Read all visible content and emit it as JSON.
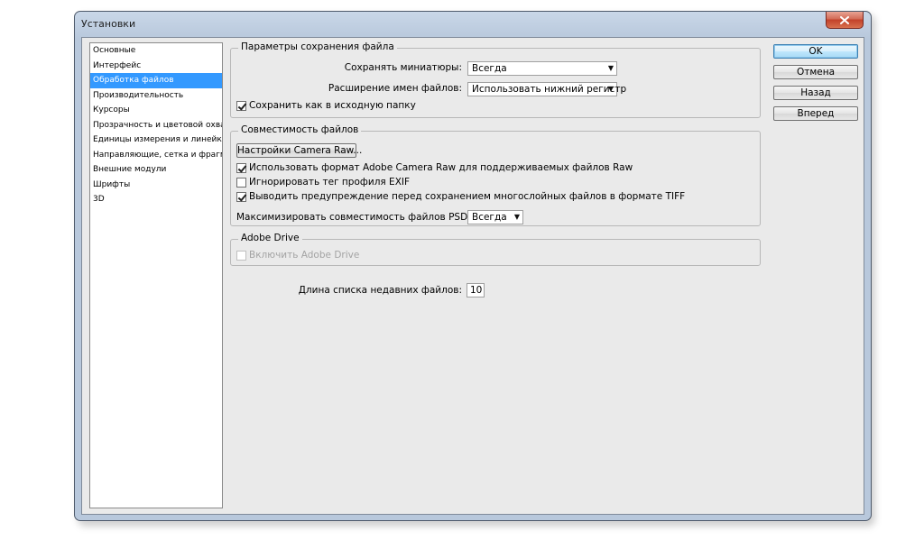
{
  "window": {
    "title": "Установки"
  },
  "sidebar": {
    "items": [
      {
        "label": "Основные"
      },
      {
        "label": "Интерфейс"
      },
      {
        "label": "Обработка файлов"
      },
      {
        "label": "Производительность"
      },
      {
        "label": "Курсоры"
      },
      {
        "label": "Прозрачность и цветовой охват"
      },
      {
        "label": "Единицы измерения и линейки"
      },
      {
        "label": "Направляющие, сетка и фрагменты"
      },
      {
        "label": "Внешние модули"
      },
      {
        "label": "Шрифты"
      },
      {
        "label": "3D"
      }
    ],
    "selected_index": 2
  },
  "save_group": {
    "title": "Параметры сохранения файла",
    "thumbnails_label": "Сохранять миниатюры:",
    "thumbnails_value": "Всегда",
    "extension_label": "Расширение имен файлов:",
    "extension_value": "Использовать нижний регистр",
    "save_original_label": "Сохранить как в исходную папку",
    "save_original_checked": true
  },
  "compat_group": {
    "title": "Совместимость файлов",
    "camera_raw_button": "Настройки Camera Raw...",
    "use_acr_label": "Использовать формат Adobe Camera Raw для поддерживаемых файлов Raw",
    "use_acr_checked": true,
    "ignore_exif_label": "Игнорировать тег профиля EXIF",
    "ignore_exif_checked": false,
    "warn_tiff_label": "Выводить предупреждение перед сохранением многослойных файлов в формате TIFF",
    "warn_tiff_checked": true,
    "maximize_label": "Максимизировать совместимость файлов PSD и PSB:",
    "maximize_value": "Всегда"
  },
  "drive_group": {
    "title": "Adobe Drive",
    "enable_label": "Включить Adobe Drive",
    "enable_checked": false
  },
  "recent": {
    "label": "Длина списка недавних файлов:",
    "value": "10"
  },
  "buttons": {
    "ok": "OK",
    "cancel": "Отмена",
    "prev": "Назад",
    "next": "Вперед"
  }
}
